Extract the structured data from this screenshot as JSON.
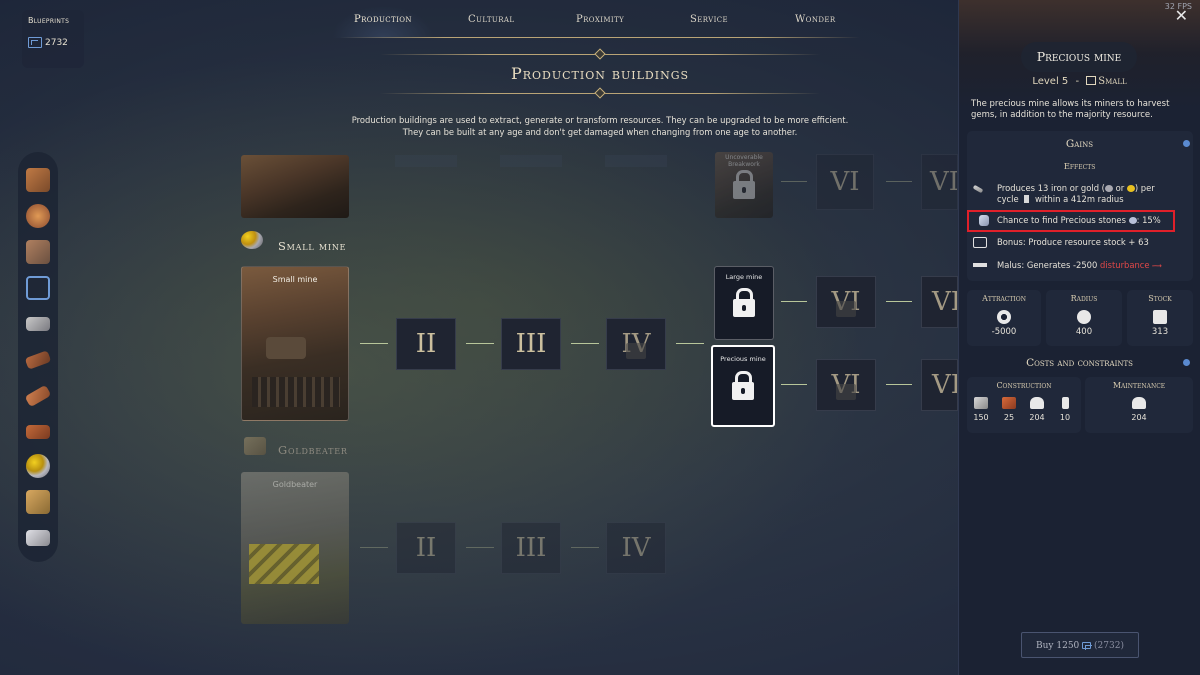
{
  "fps": "32 FPS",
  "blueprints": {
    "label": "Blueprints",
    "value": "2732",
    "icon": "blueprint-icon"
  },
  "tabs": [
    {
      "label": "Production",
      "active": true
    },
    {
      "label": "Cultural",
      "active": false
    },
    {
      "label": "Proximity",
      "active": false
    },
    {
      "label": "Service",
      "active": false
    },
    {
      "label": "Wonder",
      "active": false
    }
  ],
  "page_title": "Production buildings",
  "description_line1": "Production buildings are used to extract, generate or transform resources. They can be upgraded to be more efficient.",
  "description_line2": "They can be built at any age and don't get damaged when changing from one age to another.",
  "sidebar_icons": [
    "logs-icon",
    "ore-icon",
    "stone-pile-icon",
    "blueprint-icon",
    "iron-bar-icon",
    "wood-plank-icon",
    "copper-bar-icon",
    "brick-icon",
    "small-mine-icon",
    "goldbeater-icon",
    "silver-bar-icon"
  ],
  "tree": {
    "top_row": {
      "upgrade_label": "Uncoverable Breakwork",
      "levels": [
        "VI",
        "VI"
      ]
    },
    "small_mine": {
      "section_label": "Small mine",
      "card_title": "Small mine",
      "levels": [
        "II",
        "III",
        "IV"
      ],
      "large_mine": {
        "label": "Large mine",
        "levels": [
          "VI",
          "VI"
        ]
      },
      "precious_mine": {
        "label": "Precious mine",
        "levels": [
          "VI",
          "VI"
        ]
      }
    },
    "goldbeater": {
      "section_label": "Goldbeater",
      "card_title": "Goldbeater",
      "levels": [
        "II",
        "III",
        "IV"
      ]
    }
  },
  "panel": {
    "name": "Precious mine",
    "level": "Level 5",
    "separator": "-",
    "size": "Small",
    "description": "The precious mine allows its miners to harvest gems, in addition to the majority resource.",
    "gains_title": "Gains",
    "effects_title": "Effects",
    "effects": {
      "produces_1": "Produces 13 iron or gold (",
      "produces_or": "or",
      "produces_2": ") per",
      "produces_3": "cycle",
      "produces_4": "within a 412m radius",
      "chance": "Chance to find Precious stones",
      "chance_value": ": 15%",
      "bonus": "Bonus: Produce resource stock + 63",
      "malus_prefix": "Malus: Generates -2500",
      "malus_word": "disturbance"
    },
    "stats": [
      {
        "label": "Attraction",
        "value": "-5000",
        "icon": "attraction-icon"
      },
      {
        "label": "Radius",
        "value": "400",
        "icon": "radius-icon"
      },
      {
        "label": "Stock",
        "value": "313",
        "icon": "stock-icon"
      }
    ],
    "costs_title": "Costs and constraints",
    "construction_title": "Construction",
    "construction": [
      {
        "icon": "stone-icon",
        "value": "150"
      },
      {
        "icon": "brick-icon",
        "value": "25"
      },
      {
        "icon": "worker-icon",
        "value": "204"
      },
      {
        "icon": "hourglass-icon",
        "value": "10"
      }
    ],
    "maintenance_title": "Maintenance",
    "maintenance": [
      {
        "icon": "worker-icon",
        "value": "204"
      }
    ],
    "buy_label": "Buy 1250",
    "buy_count": "(2732)"
  },
  "colors": {
    "accent_gold": "#b9a476",
    "highlight_red": "#e0202a",
    "panel_bg": "#1b2233",
    "disturbance": "#e04848"
  }
}
